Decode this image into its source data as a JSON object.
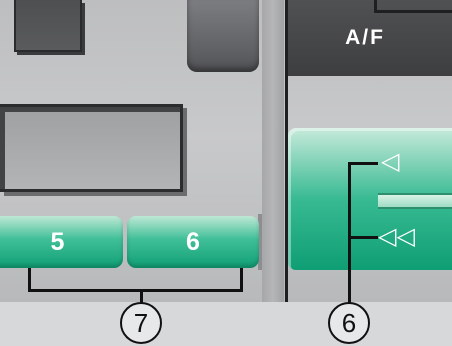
{
  "buttons": {
    "af_label": "A/F",
    "preset_5_label": "5",
    "preset_6_label": "6",
    "seek_back_glyph": "◁",
    "rewind_glyph": "◁◁"
  },
  "callouts": {
    "left_callout": "7",
    "right_callout": "6"
  },
  "colors": {
    "accent_green": "#1aa67c",
    "panel_grey": "#c0c1c3",
    "dark_button": "#4a4b4d"
  }
}
